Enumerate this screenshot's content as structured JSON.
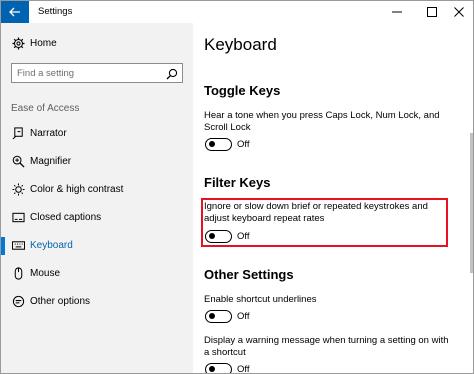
{
  "window": {
    "title": "Settings",
    "controls": {
      "minimize": "─",
      "maximize": "☐",
      "close": "✕"
    }
  },
  "colors": {
    "accent": "#0063b1",
    "active_bar": "#0078d7",
    "sidebar_bg": "#f2f2f2",
    "highlight_border": "#e81123"
  },
  "sidebar": {
    "home": {
      "icon": "gear-icon",
      "label": "Home"
    },
    "search": {
      "placeholder": "Find a setting",
      "icon": "search-icon"
    },
    "section_label": "Ease of Access",
    "items": [
      {
        "icon": "narrator-icon",
        "label": "Narrator",
        "active": false
      },
      {
        "icon": "magnifier-icon",
        "label": "Magnifier",
        "active": false
      },
      {
        "icon": "brightness-icon",
        "label": "Color & high contrast",
        "active": false
      },
      {
        "icon": "closed-captions-icon",
        "label": "Closed captions",
        "active": false
      },
      {
        "icon": "keyboard-icon",
        "label": "Keyboard",
        "active": true
      },
      {
        "icon": "mouse-icon",
        "label": "Mouse",
        "active": false
      },
      {
        "icon": "other-options-icon",
        "label": "Other options",
        "active": false
      }
    ]
  },
  "main": {
    "title": "Keyboard",
    "toggle_keys": {
      "heading": "Toggle Keys",
      "description": "Hear a tone when you press Caps Lock, Num Lock, and Scroll Lock",
      "state": "Off"
    },
    "filter_keys": {
      "heading": "Filter Keys",
      "description": "Ignore or slow down brief or repeated keystrokes and adjust keyboard repeat rates",
      "state": "Off"
    },
    "other_settings": {
      "heading": "Other Settings",
      "shortcut_underlines": {
        "description": "Enable shortcut underlines",
        "state": "Off"
      },
      "warning_message": {
        "description": "Display a warning message when turning a setting on with a shortcut",
        "state": "Off"
      }
    }
  }
}
